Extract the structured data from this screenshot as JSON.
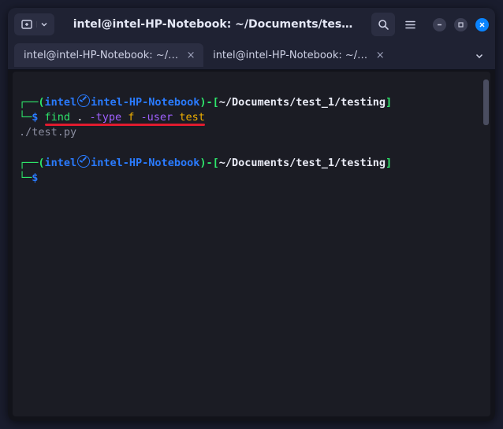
{
  "titlebar": {
    "title": "intel@intel-HP-Notebook: ~/Documents/tes…"
  },
  "tabs": [
    {
      "label": "intel@intel-HP-Notebook: ~/…",
      "active": true
    },
    {
      "label": "intel@intel-HP-Notebook: ~/…",
      "active": false
    }
  ],
  "prompt": {
    "user": "intel",
    "host": "intel-HP-Notebook",
    "path": "~/Documents/test_1/testing",
    "symbol": "$"
  },
  "command": {
    "cmd": "find",
    "arg_dot": ".",
    "flag_type": "-type",
    "val_type": "f",
    "flag_user": "-user",
    "val_user": "test"
  },
  "output": {
    "line1": "./test.py"
  },
  "colors": {
    "underline": "#e01b2f"
  }
}
